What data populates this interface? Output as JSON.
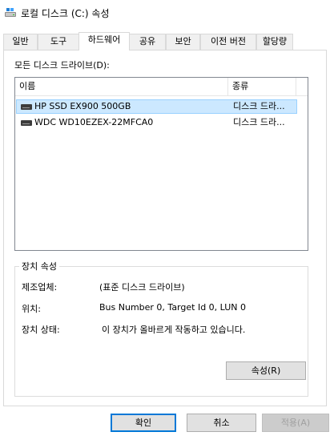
{
  "window": {
    "title": "로컬 디스크 (C:) 속성",
    "icon": "drive-icon"
  },
  "tabs": [
    {
      "label": "일반",
      "active": false
    },
    {
      "label": "도구",
      "active": false
    },
    {
      "label": "하드웨어",
      "active": true
    },
    {
      "label": "공유",
      "active": false
    },
    {
      "label": "보안",
      "active": false
    },
    {
      "label": "이전 버전",
      "active": false
    },
    {
      "label": "할당량",
      "active": false
    }
  ],
  "hardware": {
    "all_drives_label": "모든 디스크 드라이브(D):",
    "list": {
      "columns": [
        "이름",
        "종류"
      ],
      "rows": [
        {
          "name": "HP SSD EX900 500GB",
          "type": "디스크 드라...",
          "selected": true
        },
        {
          "name": "WDC WD10EZEX-22MFCA0",
          "type": "디스크 드라...",
          "selected": false
        }
      ]
    },
    "device_props": {
      "title": "장치 속성",
      "manufacturer_label": "제조업체:",
      "manufacturer_value": "(표준 디스크 드라이브)",
      "location_label": "위치:",
      "location_value": "Bus Number 0, Target Id 0, LUN 0",
      "status_label": "장치 상태:",
      "status_value": "이 장치가 올바르게 작동하고 있습니다.",
      "properties_button": "속성(R)"
    }
  },
  "footer": {
    "ok_label": "확인",
    "cancel_label": "취소",
    "apply_label": "적용(A)"
  },
  "colors": {
    "selection_bg": "#cce8ff",
    "selection_border": "#99d1ff",
    "default_button_border": "#0078d7",
    "disabled_text": "#a0a0a0"
  }
}
